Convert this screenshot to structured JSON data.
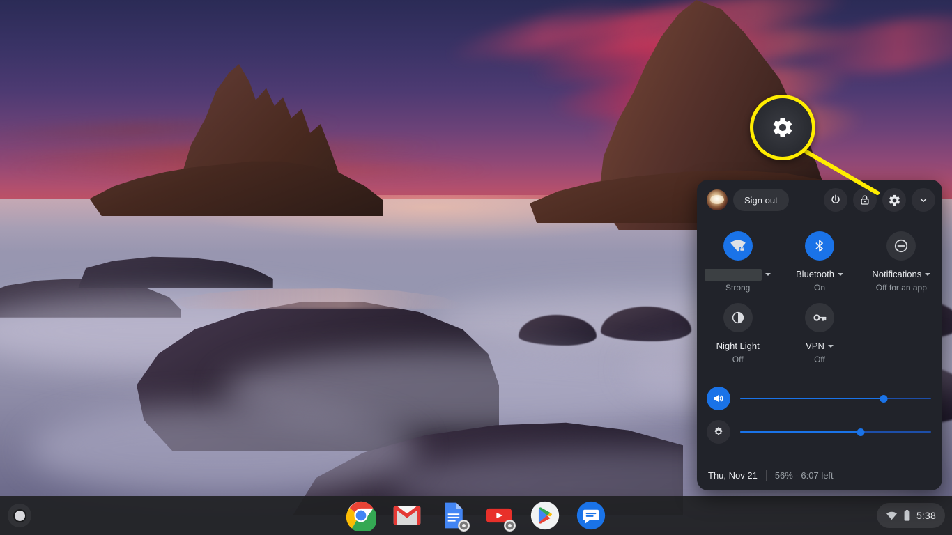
{
  "desktop": {
    "wallpaper_name": "sunset-seascape-wallpaper",
    "wallpaper_alt": "Long exposure sunset over rocky coastline"
  },
  "colors": {
    "accent_blue": "#1a73e8",
    "panel_bg": "#21232a",
    "shelf_bg": "#202124",
    "text_primary": "#e8eaed",
    "text_secondary": "#9aa0a6",
    "callout_yellow": "#ffed00"
  },
  "tray": {
    "top": {
      "avatar_label": "User avatar",
      "sign_out_label": "Sign out",
      "power_label": "Shut down",
      "lock_label": "Lock screen",
      "settings_label": "Settings",
      "collapse_label": "Collapse menu"
    },
    "tiles": [
      {
        "name": "network",
        "icon": "wifi-icon",
        "state": "on",
        "label": "",
        "label_redacted": true,
        "has_caret": true,
        "sub": "Strong"
      },
      {
        "name": "bluetooth",
        "icon": "bluetooth-icon",
        "state": "on",
        "label": "Bluetooth",
        "label_redacted": false,
        "has_caret": true,
        "sub": "On"
      },
      {
        "name": "notifications",
        "icon": "do-not-disturb-icon",
        "state": "off",
        "label": "Notifications",
        "label_redacted": false,
        "has_caret": true,
        "sub": "Off for an app"
      },
      {
        "name": "night-light",
        "icon": "night-light-icon",
        "state": "off",
        "label": "Night Light",
        "label_redacted": false,
        "has_caret": false,
        "sub": "Off"
      },
      {
        "name": "vpn",
        "icon": "vpn-key-icon",
        "state": "off",
        "label": "VPN",
        "label_redacted": false,
        "has_caret": true,
        "sub": "Off"
      }
    ],
    "sliders": [
      {
        "name": "volume",
        "icon": "volume-up-icon",
        "icon_state": "on",
        "value": 75
      },
      {
        "name": "brightness",
        "icon": "brightness-icon",
        "icon_state": "off",
        "value": 63
      }
    ],
    "footer": {
      "date": "Thu, Nov 21",
      "battery": "56% - 6:07 left"
    }
  },
  "callout": {
    "magnified_icon": "gear-icon",
    "target": "tray-settings-button"
  },
  "shelf": {
    "launcher_label": "Launcher",
    "apps": [
      {
        "name": "chrome",
        "label": "Google Chrome",
        "badge": null
      },
      {
        "name": "gmail",
        "label": "Gmail",
        "badge": null
      },
      {
        "name": "docs",
        "label": "Google Docs",
        "badge": "chrome-shortcut-badge"
      },
      {
        "name": "youtube",
        "label": "YouTube",
        "badge": "chrome-shortcut-badge"
      },
      {
        "name": "play-store",
        "label": "Play Store",
        "badge": null
      },
      {
        "name": "messages",
        "label": "Messages",
        "badge": null
      }
    ],
    "status": {
      "wifi_icon": "wifi-icon",
      "battery_icon": "battery-icon",
      "clock": "5:38"
    }
  }
}
